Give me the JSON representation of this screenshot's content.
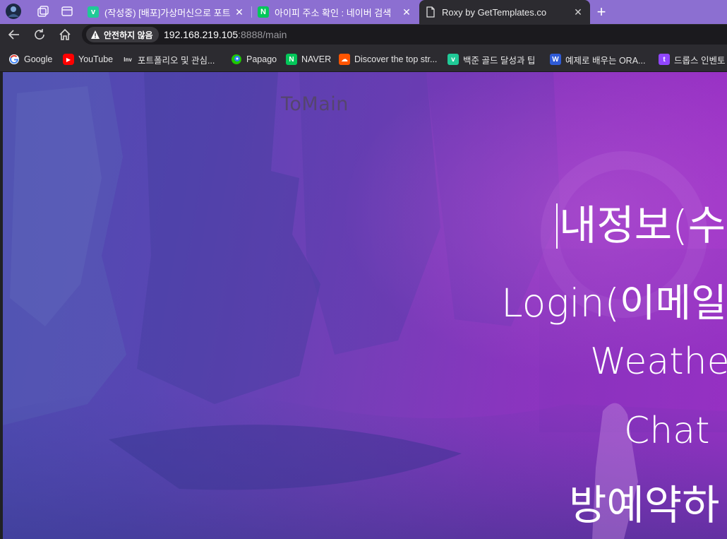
{
  "browser": {
    "tabs": [
      {
        "title": "(작성중) [배포]가상머신으로 포트",
        "favicon": "velog-icon",
        "favicon_text": "v",
        "favicon_color": "#20c997"
      },
      {
        "title": "아이피 주소 확인 : 네이버 검색",
        "favicon": "naver-icon",
        "favicon_text": "N",
        "favicon_color": "#03c75a"
      },
      {
        "title": "Roxy by GetTemplates.co",
        "favicon": "page-icon",
        "active": true
      }
    ],
    "close_glyph": "✕",
    "new_tab_glyph": "+",
    "address": {
      "security_label": "안전하지 않음",
      "host": "192.168.219.105",
      "rest": ":8888/main"
    },
    "bookmarks": [
      {
        "label": "Google",
        "icon": "google-icon",
        "icon_text": "G",
        "color": "#ffffff"
      },
      {
        "label": "YouTube",
        "icon": "youtube-icon",
        "icon_text": "▶",
        "color": "#ff0000"
      },
      {
        "label": "포트폴리오 및 관심...",
        "icon": "investing-icon",
        "icon_text": "Inv",
        "color": "#2c2b30"
      },
      {
        "label": "Papago",
        "icon": "papago-icon",
        "icon_text": "P",
        "color": "#1ec800"
      },
      {
        "label": "NAVER",
        "icon": "naver-icon",
        "icon_text": "N",
        "color": "#03c75a"
      },
      {
        "label": "Discover the top str...",
        "icon": "soundcloud-icon",
        "icon_text": "☁",
        "color": "#ff5500"
      },
      {
        "label": "백준 골드 달성과 팁",
        "icon": "velog-icon",
        "icon_text": "v",
        "color": "#20c997"
      },
      {
        "label": "예제로 배우는 ORA...",
        "icon": "w-icon",
        "icon_text": "W",
        "color": "#2f5bd6"
      },
      {
        "label": "드롭스 인벤토",
        "icon": "twitch-icon",
        "icon_text": "t",
        "color": "#9146ff"
      }
    ]
  },
  "page": {
    "nav_link": "ToMain",
    "menu": [
      "내정보(수",
      "Login(이메일",
      "Weathe",
      "Chat",
      "방예약하"
    ]
  },
  "colors": {
    "tabstrip": "#8c6fd1",
    "toolbar": "#2c2b30",
    "page_gradient_start": "#4d4ab0",
    "page_gradient_end": "#a22fc8"
  }
}
